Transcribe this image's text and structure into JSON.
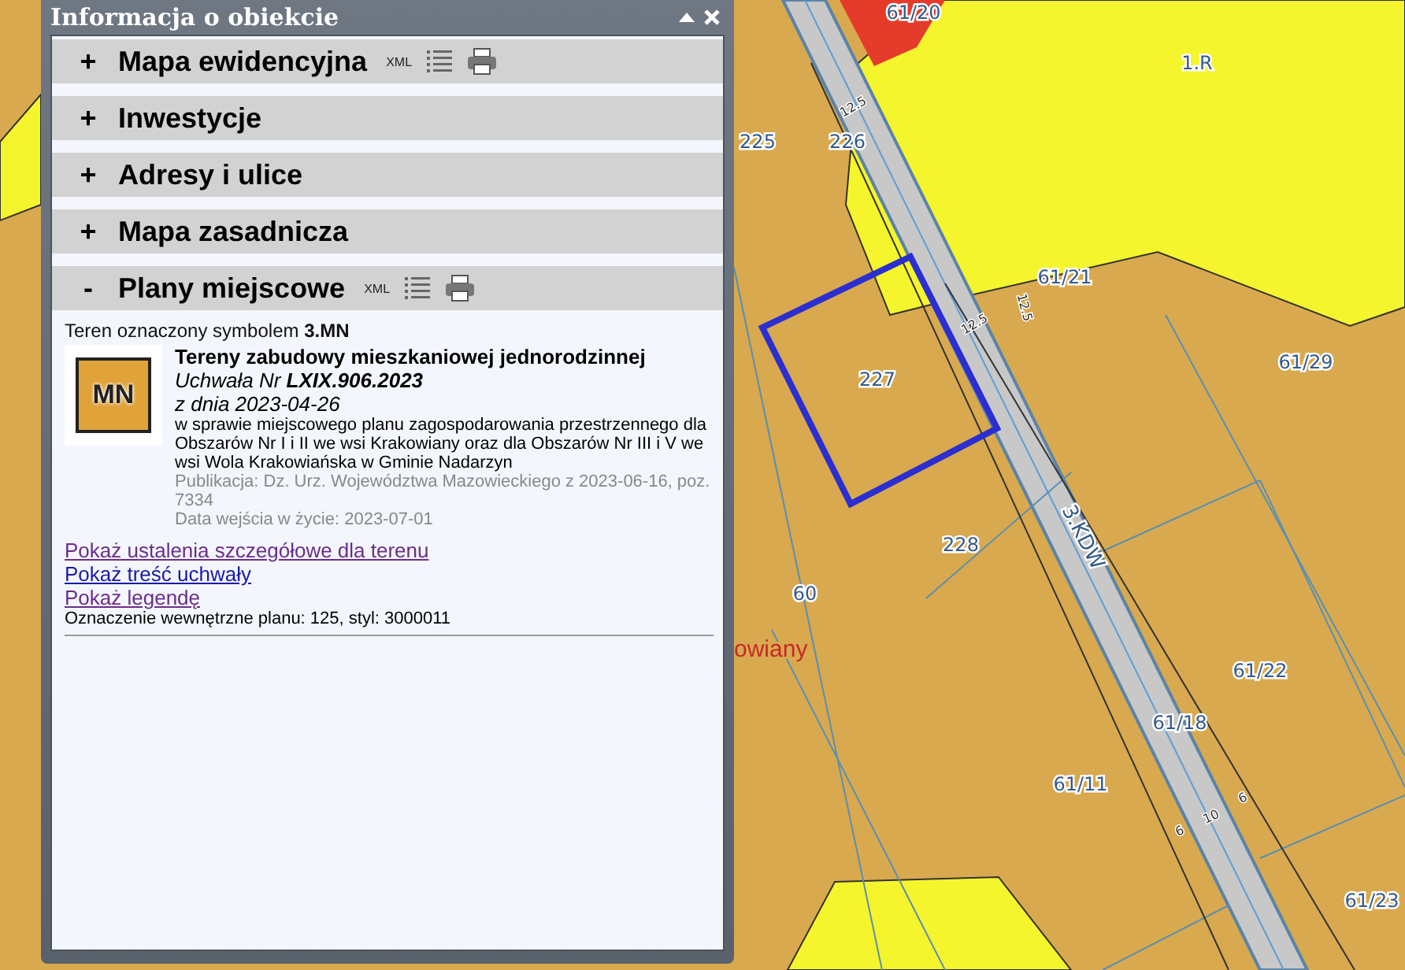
{
  "map": {
    "labels": [
      {
        "text": "61/20",
        "kind": "parcel"
      },
      {
        "text": "1.R",
        "kind": "parcel"
      },
      {
        "text": "225",
        "kind": "parcel"
      },
      {
        "text": "226",
        "kind": "parcel"
      },
      {
        "text": "12.5",
        "kind": "dimension"
      },
      {
        "text": "61/21",
        "kind": "parcel"
      },
      {
        "text": "12.5",
        "kind": "dimension"
      },
      {
        "text": "12.5",
        "kind": "dimension"
      },
      {
        "text": "61/29",
        "kind": "parcel"
      },
      {
        "text": "227",
        "kind": "parcel"
      },
      {
        "text": "3.KDW",
        "kind": "road"
      },
      {
        "text": "228",
        "kind": "parcel"
      },
      {
        "text": "60",
        "kind": "parcel"
      },
      {
        "text": "61/22",
        "kind": "parcel"
      },
      {
        "text": "61/18",
        "kind": "parcel"
      },
      {
        "text": "61/11",
        "kind": "parcel"
      },
      {
        "text": "6",
        "kind": "dimension"
      },
      {
        "text": "10",
        "kind": "dimension"
      },
      {
        "text": "6",
        "kind": "dimension"
      },
      {
        "text": "61/23",
        "kind": "parcel"
      }
    ],
    "place_name": "owiany"
  },
  "panel": {
    "title": "Informacja o obiekcie",
    "sections": [
      {
        "sign": "+",
        "label": "Mapa ewidencyjna",
        "expanded": false,
        "tools": true,
        "xml": "XML"
      },
      {
        "sign": "+",
        "label": "Inwestycje",
        "expanded": false,
        "tools": false
      },
      {
        "sign": "+",
        "label": "Adresy i ulice",
        "expanded": false,
        "tools": false
      },
      {
        "sign": "+",
        "label": "Mapa zasadnicza",
        "expanded": false,
        "tools": false
      },
      {
        "sign": "-",
        "label": "Plany miejscowe",
        "expanded": true,
        "tools": true,
        "xml": "XML"
      }
    ],
    "detail": {
      "heading": "Teren oznaczony symbolem **3.MN**",
      "symbol": "MN",
      "title": "Tereny zabudowy mieszkaniowej jednorodzinnej",
      "resolution": "Uchwała Nr **LXIX.906.2023**",
      "date": "z dnia 2023-04-26",
      "subject": "w sprawie miejscowego planu zagospodarowania przestrzennego dla Obszarów Nr I i II we wsi Krakowiany oraz dla Obszarów Nr III i V we wsi Wola Krakowiańska w Gminie Nadarzyn",
      "publication": "Publikacja: Dz. Urz. Województwa Mazowieckiego z 2023-06-16, poz. 7334",
      "effective": "Data wejścia w życie: 2023-07-01",
      "links": [
        {
          "text": "Pokaż ustalenia szczegółowe dla terenu",
          "visited": true
        },
        {
          "text": "Pokaż treść uchwały",
          "visited": false
        },
        {
          "text": "Pokaż legendę",
          "visited": true
        }
      ],
      "internal": "Oznaczenie wewnętrzne planu: 125, styl: 3000011"
    }
  }
}
